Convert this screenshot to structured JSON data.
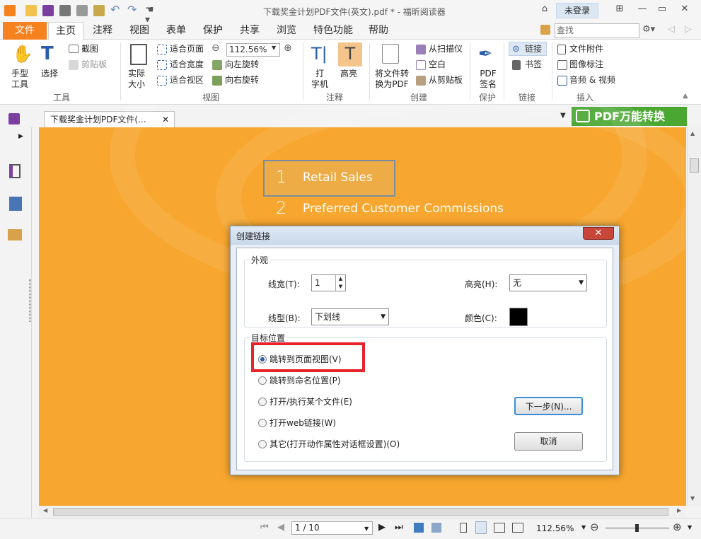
{
  "window": {
    "title": "下载奖金计划PDF文件(英文).pdf * - 福昕阅读器",
    "login": "未登录"
  },
  "menu": {
    "items": [
      "文件",
      "主页",
      "注释",
      "视图",
      "表单",
      "保护",
      "共享",
      "浏览",
      "特色功能",
      "帮助"
    ],
    "search_placeholder": "查找"
  },
  "ribbon": {
    "tools": {
      "hand": "手型\n工具",
      "select": "选择",
      "snapshot": "截图",
      "clipboard": "剪贴板",
      "group": "工具"
    },
    "view": {
      "actual_size": "实际\n大小",
      "fit_page": "适合页面",
      "fit_width": "适合宽度",
      "fit_visible": "适合视区",
      "zoom": "112.56%",
      "rotate_left": "向左旋转",
      "rotate_right": "向右旋转",
      "group": "视图"
    },
    "comment": {
      "typewriter": "打\n字机",
      "highlight": "高亮",
      "group": "注释"
    },
    "create": {
      "convert": "将文件转\n换为PDF",
      "from_scanner": "从扫描仪",
      "blank": "空白",
      "from_clipboard": "从剪贴板",
      "group": "创建"
    },
    "protect": {
      "sign": "PDF\n签名",
      "group": "保护"
    },
    "links": {
      "link": "链接",
      "bookmark": "书签",
      "group": "链接"
    },
    "insert": {
      "attachment": "文件附件",
      "image": "图像标注",
      "av": "音频 & 视频",
      "group": "插入"
    }
  },
  "tab": {
    "doc_name": "下载奖金计划PDF文件(..."
  },
  "promo": {
    "text": "PDF万能转换"
  },
  "document": {
    "toc": [
      {
        "num": "1",
        "text": "Retail Sales"
      },
      {
        "num": "2",
        "text": "Preferred Customer Commissions"
      }
    ]
  },
  "dialog": {
    "title": "创建链接",
    "appearance": {
      "legend": "外观",
      "line_width_label": "线宽(T):",
      "line_width_value": "1",
      "highlight_label": "高亮(H):",
      "highlight_value": "无",
      "line_style_label": "线型(B):",
      "line_style_value": "下划线",
      "color_label": "颜色(C):",
      "color_value": "#000000"
    },
    "target": {
      "legend": "目标位置",
      "options": [
        {
          "label": "跳转到页面视图(V)",
          "selected": true
        },
        {
          "label": "跳转到命名位置(P)",
          "selected": false
        },
        {
          "label": "打开/执行某个文件(E)",
          "selected": false
        },
        {
          "label": "打开web链接(W)",
          "selected": false
        },
        {
          "label": "其它(打开动作属性对话框设置)(O)",
          "selected": false
        }
      ]
    },
    "next_button": "下一步(N)...",
    "cancel_button": "取消"
  },
  "status": {
    "page": "1 / 10",
    "zoom": "112.56%"
  },
  "colors": {
    "accent": "#f6811f",
    "doc_bg": "#f7a72f",
    "highlight_border": "#e8232a",
    "promo": "#4aa832"
  }
}
